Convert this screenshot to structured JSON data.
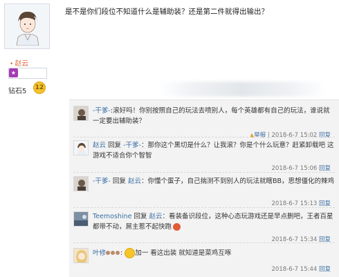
{
  "profile": {
    "user_name": "赵云",
    "rank_label": "钻石5",
    "rank_level": "12"
  },
  "post": {
    "question": "是不是你们段位不知道什么是辅助装？还是第二件就得出输出？"
  },
  "replies": [
    {
      "user": "-干爹-",
      "sep": ":",
      "text": "滚好吗！你别按照自己的玩法去喷别人，每个英雄都有自己的玩法，谁说就一定要出辅助装？",
      "report": "举报",
      "timestamp": "2018-6-7 15:02",
      "reply_label": "回复"
    },
    {
      "user": "赵云",
      "reply_word": "回复",
      "target": "-干爹-",
      "text": "：那你这个黑切是什么？让我滚？你是个什么玩意？赶紧卸载吧 这游戏不适合你个智智",
      "timestamp": "2018-6-7 15:06",
      "reply_label": "回复"
    },
    {
      "user": "-干爹-",
      "reply_word": "回复",
      "target": "赵云",
      "text": "：你懂个蛋子，自己揣测不到别人的玩法就瞎BB，思想僵化的辣鸡",
      "timestamp": "2018-6-7 15:13",
      "reply_label": "回复"
    },
    {
      "user": "Teemoshine",
      "reply_word": "回复",
      "target": "赵云",
      "text": "：看装备识段位，这种心态玩游戏还是早点删吧，王者百星都带不动，屌主惹不起快跑",
      "timestamp": "2018-6-7 15:34",
      "reply_label": "回复"
    },
    {
      "user": "叶修",
      "text": "加一 看这出装 就知道是菜鸡互啄",
      "timestamp": "2018-6-7 15:44",
      "reply_label": "回复"
    }
  ]
}
